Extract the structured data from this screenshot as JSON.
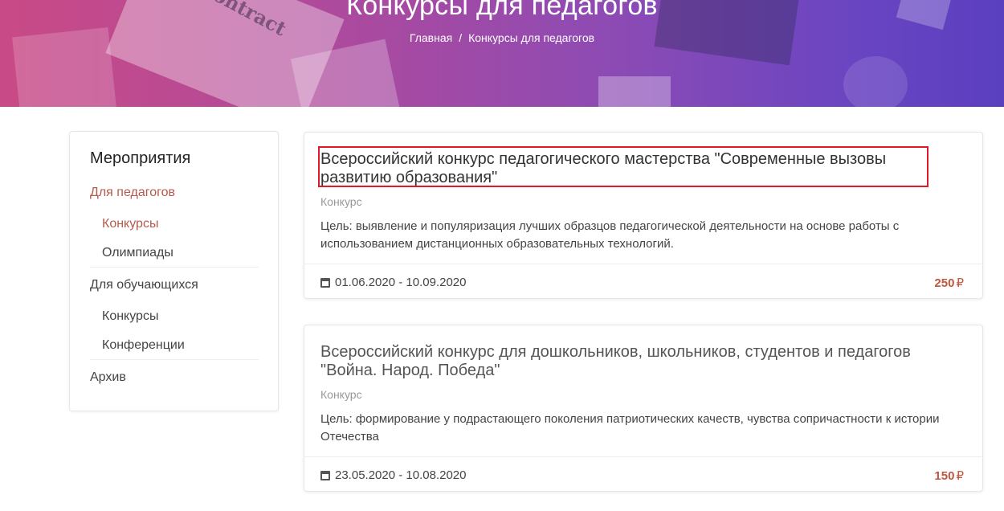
{
  "hero": {
    "title": "Конкурсы для педагогов",
    "decor_word": "ontract",
    "breadcrumb": {
      "home": "Главная",
      "separator": "/",
      "current": "Конкурсы для педагогов"
    }
  },
  "sidebar": {
    "title": "Мероприятия",
    "items": [
      {
        "label": "Для педагогов",
        "active": true
      },
      {
        "label": "Конкурсы",
        "active": true
      },
      {
        "label": "Олимпиады",
        "active": false
      },
      {
        "label": "Для обучающихся",
        "active": false
      },
      {
        "label": "Конкурсы",
        "active": false
      },
      {
        "label": "Конференции",
        "active": false
      },
      {
        "label": "Архив",
        "active": false
      }
    ]
  },
  "cards": [
    {
      "title": "Всероссийский конкурс педагогического мастерства \"Современные вызовы развитию образования\"",
      "type": "Конкурс",
      "description": "Цель: выявление и популяризация лучших образцов педагогической деятельности на основе работы с использованием дистанционных образовательных технологий.",
      "dates": "01.06.2020 - 10.09.2020",
      "price": "250",
      "currency": "₽"
    },
    {
      "title": "Всероссийский конкурс для дошкольников, школьников, студентов и педагогов \"Война. Народ. Победа\"",
      "type": "Конкурс",
      "description": "Цель: формирование у подрастающего поколения патриотических качеств, чувства сопричастности к истории Отечества",
      "dates": "23.05.2020 - 10.08.2020",
      "price": "150",
      "currency": "₽"
    }
  ],
  "colors": {
    "accent": "#b65a4b",
    "price": "#c0563f",
    "highlight": "#e0192a"
  }
}
